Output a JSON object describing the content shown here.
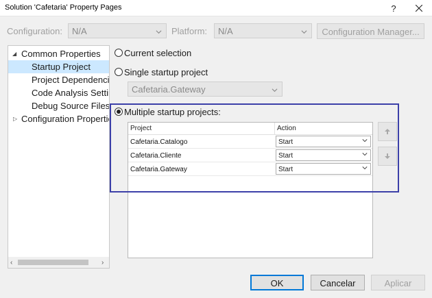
{
  "window": {
    "title": "Solution 'Cafetaria' Property Pages",
    "help_label": "?"
  },
  "toolbar": {
    "configuration_label": "Configuration:",
    "configuration_value": "N/A",
    "platform_label": "Platform:",
    "platform_value": "N/A",
    "configuration_manager_label": "Configuration Manager..."
  },
  "tree": {
    "items": [
      {
        "label": "Common Properties",
        "expanded": true
      },
      {
        "label": "Startup Project",
        "selected": true
      },
      {
        "label": "Project Dependencie"
      },
      {
        "label": "Code Analysis Settin"
      },
      {
        "label": "Debug Source Files"
      },
      {
        "label": "Configuration Propertie",
        "expanded": false
      }
    ]
  },
  "options": {
    "current_selection_label": "Current selection",
    "single_startup_label": "Single startup project",
    "single_startup_value": "Cafetaria.Gateway",
    "multiple_startup_label": "Multiple startup projects:",
    "selected": "multiple"
  },
  "grid": {
    "columns": [
      "Project",
      "Action"
    ],
    "rows": [
      {
        "project": "Cafetaria.Catalogo",
        "action": "Start"
      },
      {
        "project": "Cafetaria.Cliente",
        "action": "Start"
      },
      {
        "project": "Cafetaria.Gateway",
        "action": "Start"
      }
    ]
  },
  "buttons": {
    "ok": "OK",
    "cancel": "Cancelar",
    "apply": "Aplicar"
  },
  "colors": {
    "highlight_border": "#3b3fa8",
    "selected_tree_item": "#cce8ff",
    "default_button_border": "#0078d7"
  }
}
